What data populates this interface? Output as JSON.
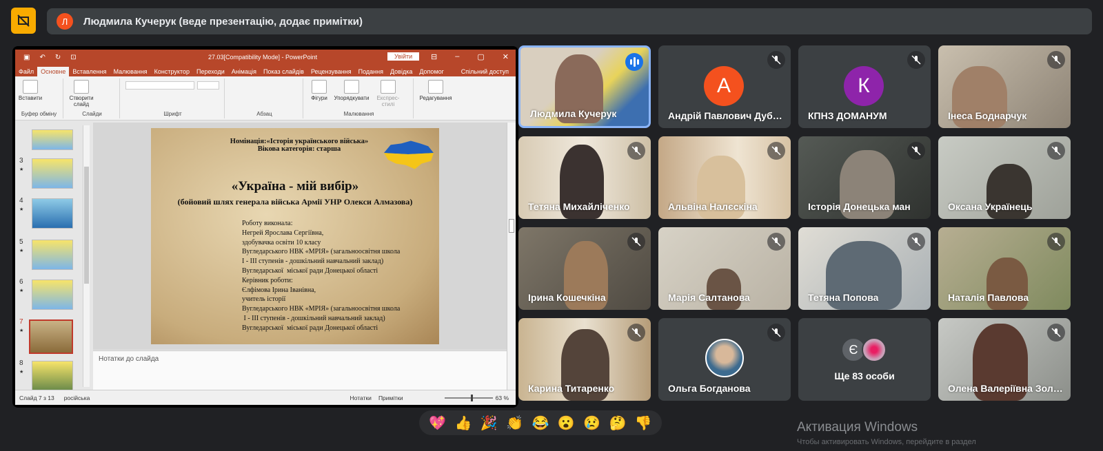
{
  "presenter_bar": {
    "avatar_letter": "Л",
    "text": "Людмила Кучерук (веде презентацію, додає примітки)"
  },
  "powerpoint": {
    "window_title": "27.03[Compatibility Mode] - PowerPoint",
    "login_button": "Увійти",
    "tabs": [
      "Файл",
      "Основне",
      "Вставлення",
      "Малювання",
      "Конструктор",
      "Переходи",
      "Анімація",
      "Показ слайдів",
      "Рецензування",
      "Подання",
      "Довідка",
      "Допомог"
    ],
    "share_label": "Спільний доступ",
    "ribbon": {
      "paste": "Вставити",
      "clipboard": "Буфер обміну",
      "new_slide": "Створити слайд",
      "slides": "Слайди",
      "font": "Шрифт",
      "paragraph": "Абзац",
      "shapes": "Фігури",
      "arrange": "Упорядкувати",
      "quick_styles": "Експрес-стилі",
      "drawing": "Малювання",
      "editing": "Редагування"
    },
    "thumbnails": [
      "3",
      "4",
      "5",
      "6",
      "7",
      "8"
    ],
    "selected_thumbnail": "7",
    "slide": {
      "nomination": "Номінація:«Історія українського війська»",
      "age_category": "Вікова категорія: старша",
      "title": "«Україна - мій вибір»",
      "subtitle": "(бойовий шлях генерала війська Армії УНР Олекси Алмазова)",
      "body": "Роботу виконала:\nНегрей Ярослава Сергіївна,\nздобувачка освіти 10 класу\nВугледарського НВК «МРІЯ» (загальноосвітня школа\nІ - ІІІ ступенів - дошкільний навчальний заклад)\nВугледарської  міської ради Донецької області\nКерівник роботи:\nЄлфімова Ірина Іванівна,\nучитель історії\nВугледарського НВК «МРІЯ» (загальноосвітня школа\n І - ІІІ ступенів - дошкільний навчальний заклад)\nВугледарської  міської ради Донецької області"
    },
    "notes_placeholder": "Нотатки до слайда",
    "status": {
      "slide_count": "Слайд 7 з 13",
      "language": "російська",
      "notes": "Нотатки",
      "comments": "Примітки",
      "zoom": "63 %"
    }
  },
  "participants": [
    {
      "name": "Людмила Кучерук",
      "type": "video",
      "speaking": true
    },
    {
      "name": "Андрій Павлович Дуб…",
      "type": "avatar",
      "letter": "А",
      "color": "#f4511e"
    },
    {
      "name": "КПНЗ ДОМАНУМ",
      "type": "avatar",
      "letter": "К",
      "color": "#8e24aa"
    },
    {
      "name": "Інеса Боднарчук",
      "type": "video"
    },
    {
      "name": "Тетяна Михайліченко",
      "type": "video"
    },
    {
      "name": "Альвіна Налєскіна",
      "type": "video"
    },
    {
      "name": "Історія Донецька ман",
      "type": "video"
    },
    {
      "name": "Оксана Українець",
      "type": "video"
    },
    {
      "name": "Ірина Кошечкіна",
      "type": "video"
    },
    {
      "name": "Марія Салтанова",
      "type": "video"
    },
    {
      "name": "Тетяна Попова",
      "type": "video"
    },
    {
      "name": "Наталія Павлова",
      "type": "video"
    },
    {
      "name": "Карина Титаренко",
      "type": "video"
    },
    {
      "name": "Ольга Богданова",
      "type": "photo"
    },
    {
      "name": "Ще 83 особи",
      "type": "more",
      "letter": "Є"
    },
    {
      "name": "Олена Валеріївна Зол…",
      "type": "video"
    }
  ],
  "reactions": [
    "💖",
    "👍",
    "🎉",
    "👏",
    "😂",
    "😮",
    "😢",
    "🤔",
    "👎"
  ],
  "watermark": {
    "title": "Активация Windows",
    "subtitle": "Чтобы активировать Windows, перейдите в раздел"
  }
}
